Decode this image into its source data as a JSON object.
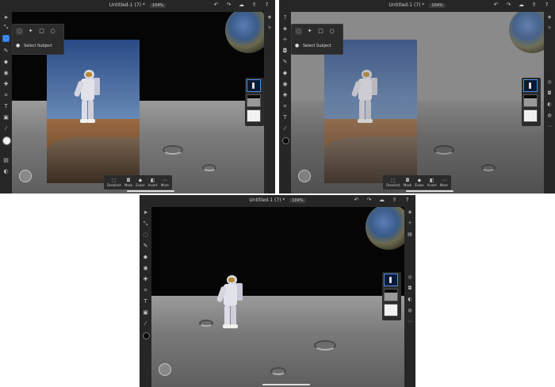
{
  "panels": [
    {
      "title": "Untitled-1 (7) *",
      "zoom": "104%",
      "selection_popup": {
        "label": "Select Subject"
      },
      "bottom_actions": [
        "Deselect",
        "Mask",
        "Erase",
        "Invert",
        "More"
      ]
    },
    {
      "title": "Untitled-1 (7) *",
      "zoom": "104%",
      "selection_popup": {
        "label": "Select Subject"
      },
      "bottom_actions": [
        "Deselect",
        "Mask",
        "Erase",
        "Invert",
        "More"
      ]
    },
    {
      "title": "Untitled-1 (7) *",
      "zoom": "104%"
    }
  ],
  "icons": {
    "undo": "undo-icon",
    "redo": "redo-icon",
    "cloud": "cloud-icon",
    "share": "share-icon",
    "help": "help-icon"
  },
  "colors": {
    "accent": "#2c7be5",
    "toolbar_bg": "#262626"
  }
}
